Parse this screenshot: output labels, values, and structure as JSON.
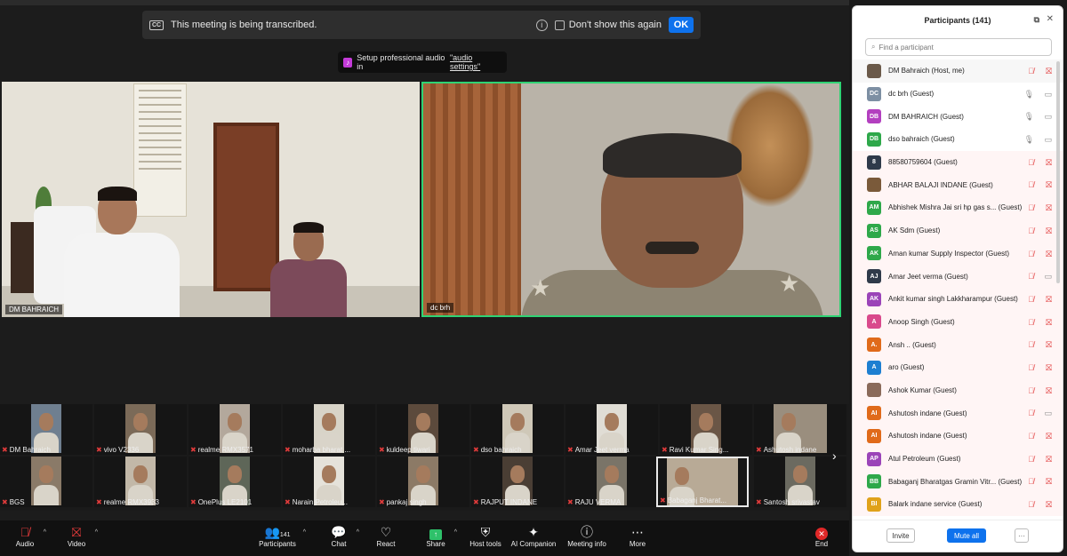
{
  "banner": {
    "cc_icon": "CC",
    "message": "This meeting is being transcribed.",
    "checkbox_label": "Don't show this again",
    "ok_label": "OK"
  },
  "audio_tip": {
    "text": "Setup professional audio in",
    "link": "\"audio settings\""
  },
  "main_videos": [
    {
      "name": "DM BAHRAICH"
    },
    {
      "name": "dc brh"
    }
  ],
  "gallery": [
    {
      "label": "DM Bahraich"
    },
    {
      "label": "vivo V2336"
    },
    {
      "label": "realme RMX3571"
    },
    {
      "label": "moharba bharat ..."
    },
    {
      "label": "kuldeep tiwari"
    },
    {
      "label": "dso bahraich"
    },
    {
      "label": "Amar Jeet verma"
    },
    {
      "label": "Ravi Kumar Sing..."
    },
    {
      "label": "Ashutosh indane"
    },
    {
      "label": "BGS"
    },
    {
      "label": "realme RMX3933"
    },
    {
      "label": "OnePlus LE2101"
    },
    {
      "label": "Narain Petroleu..."
    },
    {
      "label": "pankaj singh"
    },
    {
      "label": "RAJPUT INDANE"
    },
    {
      "label": "RAJU VERMA"
    },
    {
      "label": "Babaganj Bharat..."
    },
    {
      "label": "Santosh srivastav"
    }
  ],
  "toolbar": {
    "audio": "Audio",
    "video": "Video",
    "participants": "Participants",
    "participant_count": "141",
    "chat": "Chat",
    "react": "React",
    "share": "Share",
    "host_tools": "Host tools",
    "ai_companion": "AI Companion",
    "meeting_info": "Meeting info",
    "more": "More",
    "end": "End"
  },
  "panel": {
    "title": "Participants (141)",
    "search_placeholder": "Find a participant",
    "invite": "Invite",
    "mute_all": "Mute all",
    "more": "···",
    "participants": [
      {
        "initials": "",
        "name": "DM Bahraich (Host, me)",
        "color": "#6b5a4a",
        "mic": "off",
        "cam": "off"
      },
      {
        "initials": "DC",
        "name": "dc brh (Guest)",
        "color": "#7d8fa3",
        "mic": "on",
        "cam": "on"
      },
      {
        "initials": "DB",
        "name": "DM BAHRAICH (Guest)",
        "color": "#b33fbf",
        "mic": "on",
        "cam": "on"
      },
      {
        "initials": "DB",
        "name": "dso bahraich (Guest)",
        "color": "#2ea84a",
        "mic": "on",
        "cam": "on"
      },
      {
        "initials": "8",
        "name": "88580759604 (Guest)",
        "color": "#2f3a4a",
        "mic": "off",
        "cam": "off"
      },
      {
        "initials": "",
        "name": "ABHAR BALAJI INDANE (Guest)",
        "color": "#7a5a3a",
        "mic": "off",
        "cam": "off"
      },
      {
        "initials": "AM",
        "name": "Abhishek Mishra Jai sri hp gas s... (Guest)",
        "color": "#2ea84a",
        "mic": "off",
        "cam": "off"
      },
      {
        "initials": "AS",
        "name": "AK Sdm (Guest)",
        "color": "#2ea84a",
        "mic": "off",
        "cam": "off"
      },
      {
        "initials": "AK",
        "name": "Aman kumar Supply Inspector (Guest)",
        "color": "#2ea84a",
        "mic": "off",
        "cam": "off"
      },
      {
        "initials": "AJ",
        "name": "Amar Jeet verma (Guest)",
        "color": "#2f3a4a",
        "mic": "off",
        "cam": "on"
      },
      {
        "initials": "AK",
        "name": "Ankit kumar singh Lakkharampur (Guest)",
        "color": "#9b44b8",
        "mic": "off",
        "cam": "off"
      },
      {
        "initials": "A",
        "name": "Anoop Singh (Guest)",
        "color": "#d94a8c",
        "mic": "off",
        "cam": "off"
      },
      {
        "initials": "A.",
        "name": "Ansh .. (Guest)",
        "color": "#e06a1a",
        "mic": "off",
        "cam": "off"
      },
      {
        "initials": "A",
        "name": "aro (Guest)",
        "color": "#1e7fd1",
        "mic": "off",
        "cam": "off"
      },
      {
        "initials": "",
        "name": "Ashok Kumar (Guest)",
        "color": "#8a6a5a",
        "mic": "off",
        "cam": "off"
      },
      {
        "initials": "AI",
        "name": "Ashutosh indane (Guest)",
        "color": "#e06a1a",
        "mic": "off",
        "cam": "on"
      },
      {
        "initials": "AI",
        "name": "Ashutosh indane (Guest)",
        "color": "#e06a1a",
        "mic": "off",
        "cam": "off"
      },
      {
        "initials": "AP",
        "name": "Atul Petroleum (Guest)",
        "color": "#9b44b8",
        "mic": "off",
        "cam": "off"
      },
      {
        "initials": "BB",
        "name": "Babaganj Bharatgas Gramin Vitr... (Guest)",
        "color": "#2ea84a",
        "mic": "off",
        "cam": "off"
      },
      {
        "initials": "BI",
        "name": "Balark indane service (Guest)",
        "color": "#e0a21a",
        "mic": "off",
        "cam": "off"
      }
    ]
  }
}
